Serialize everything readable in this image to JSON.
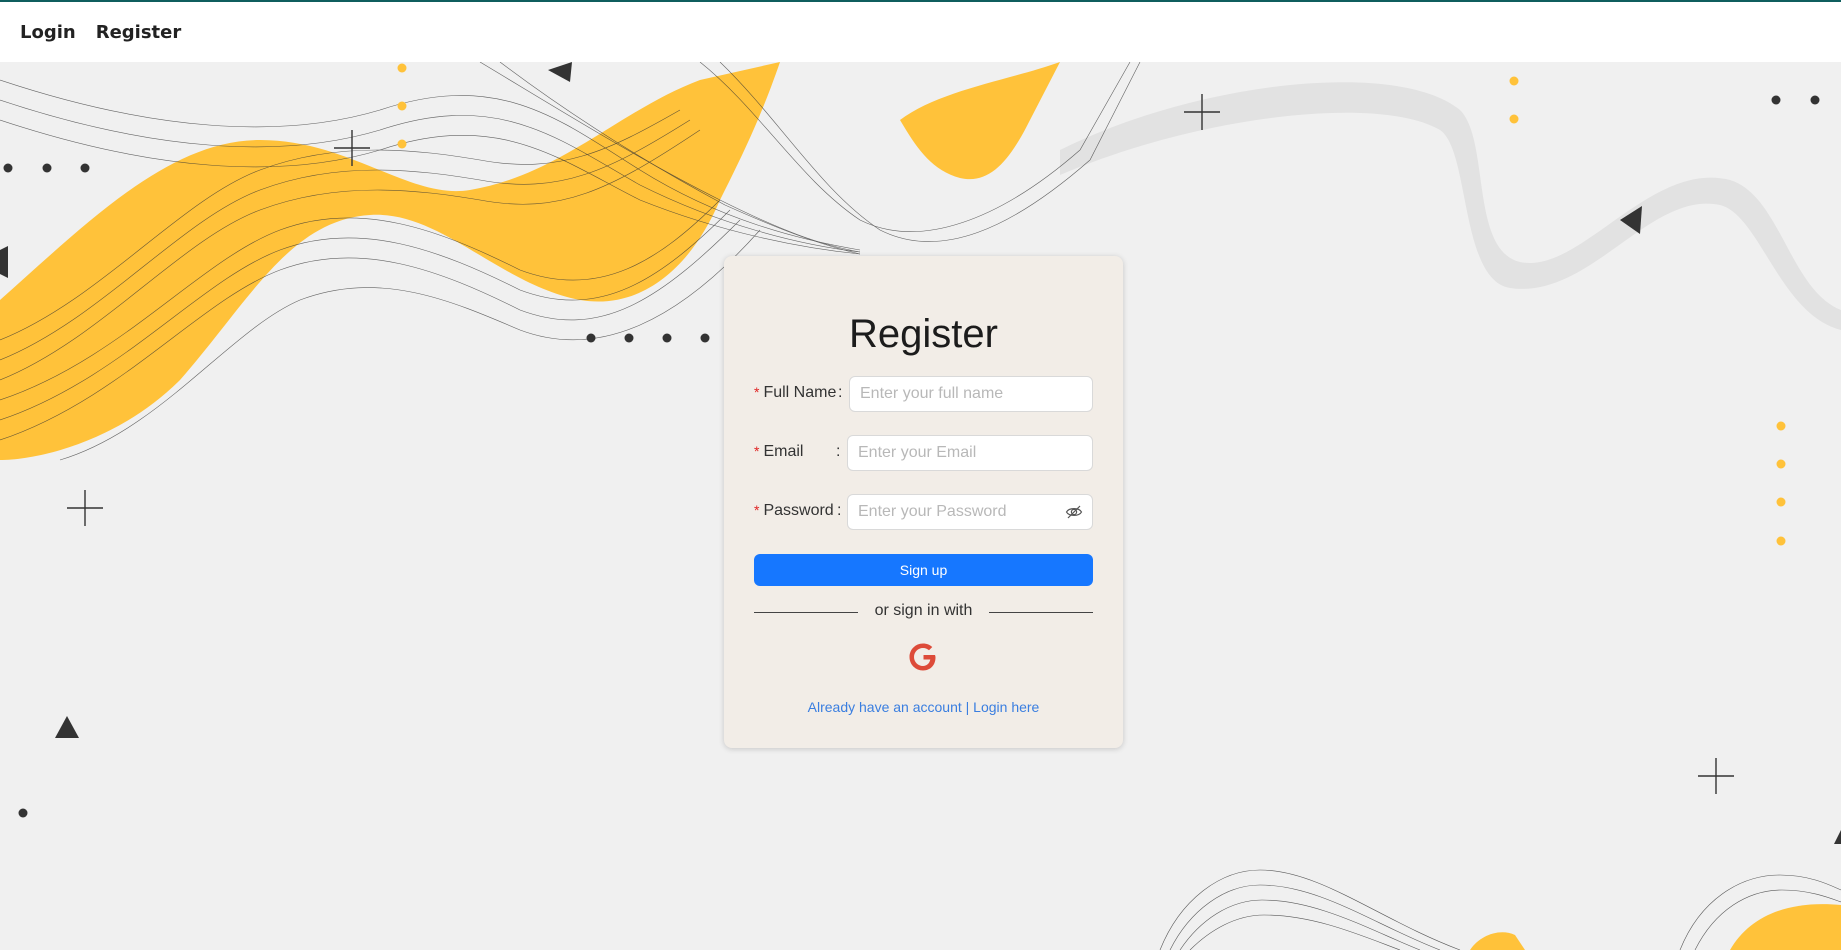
{
  "navbar": {
    "login_label": "Login",
    "register_label": "Register"
  },
  "register_form": {
    "title": "Register",
    "full_name": {
      "label": "Full Name",
      "placeholder": "Enter your full name",
      "value": ""
    },
    "email": {
      "label": "Email",
      "placeholder": "Enter your Email",
      "value": ""
    },
    "password": {
      "label": "Password",
      "placeholder": "Enter your Password",
      "value": ""
    },
    "required_mark": "*",
    "colon": ":",
    "signup_label": "Sign up",
    "divider_text": "or sign in with",
    "social_icon": "google-icon",
    "login_link": "Already have an account | Login here"
  },
  "colors": {
    "accent": "#1677ff",
    "link": "#3a7ee0",
    "wave": "#ffc23a",
    "card_bg": "#f2ede7",
    "page_bg": "#f0f0f0"
  }
}
